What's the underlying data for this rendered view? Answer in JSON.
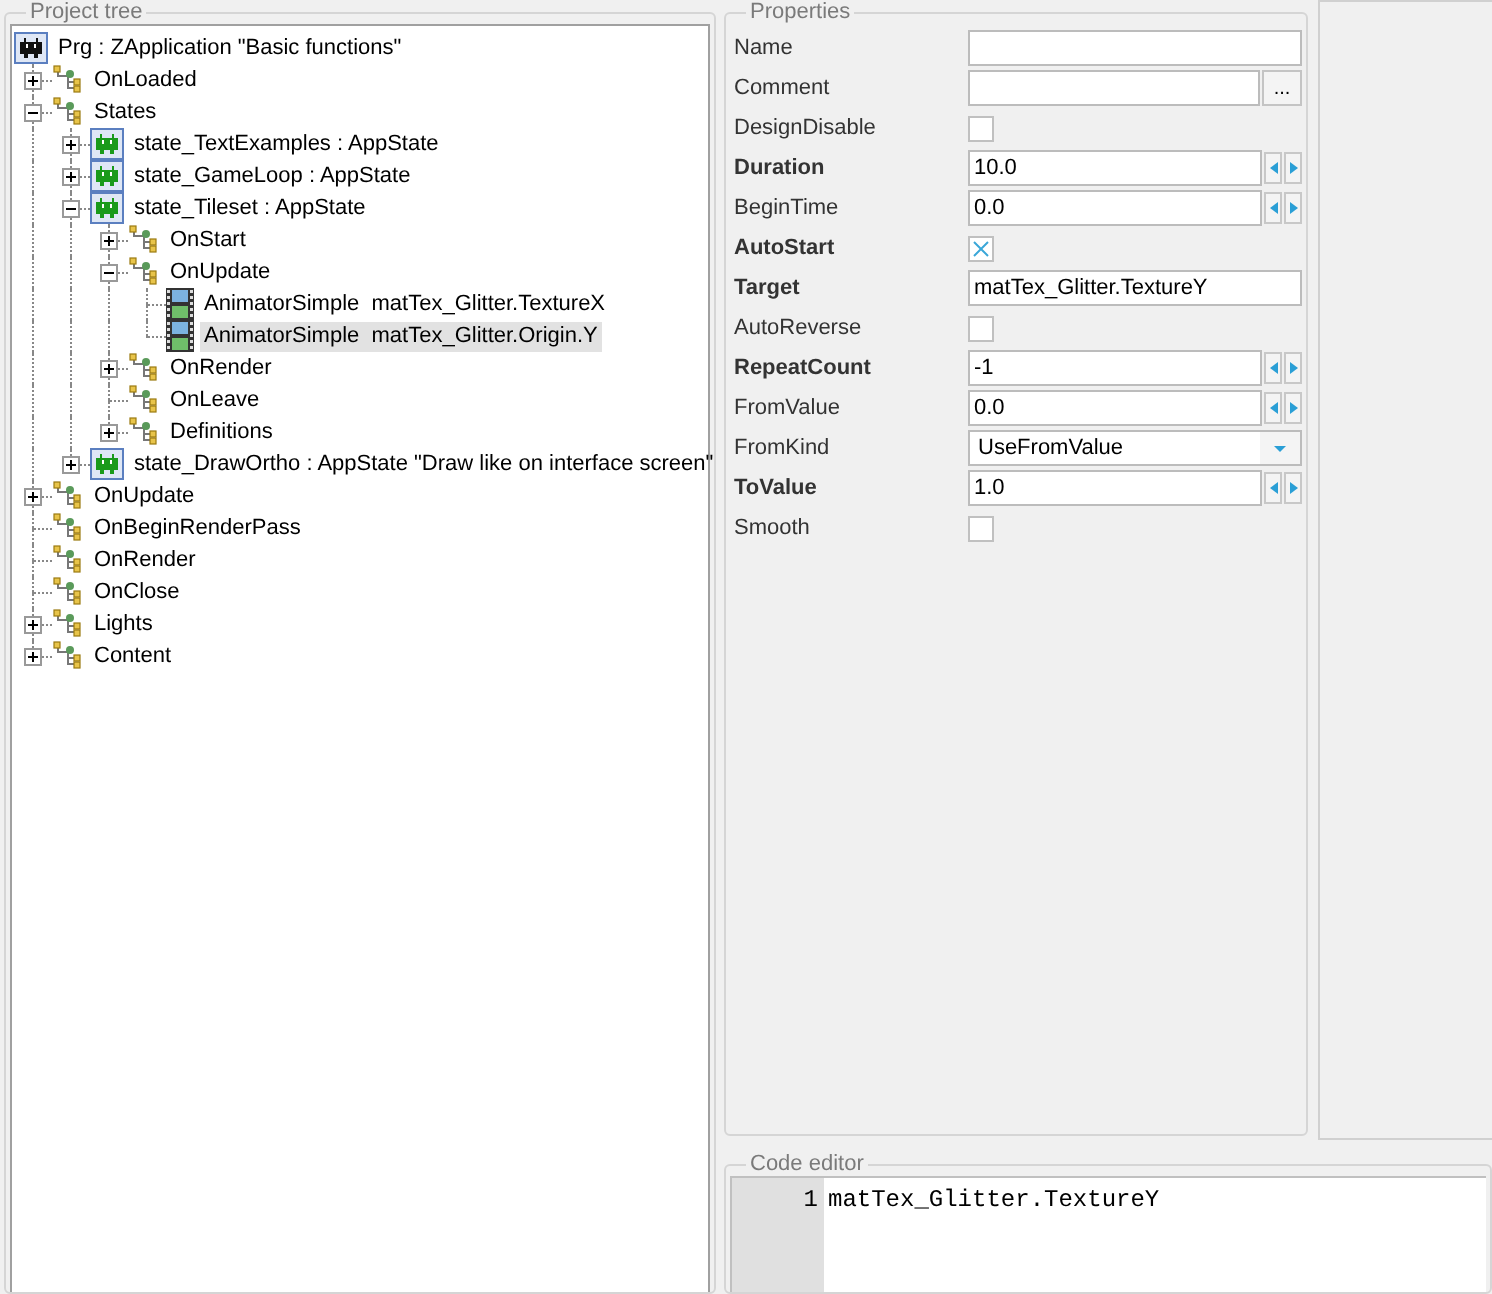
{
  "project_tree": {
    "title": "Project tree",
    "root": {
      "label": "Prg : ZApplication \"Basic functions\"",
      "kind": "app",
      "selected": false,
      "children": [
        {
          "label": "OnLoaded",
          "kind": "component",
          "expanded": false,
          "selected": false
        },
        {
          "label": "States",
          "kind": "component",
          "expanded": true,
          "selected": false,
          "children": [
            {
              "label": "state_TextExamples : AppState",
              "kind": "state",
              "expanded": false,
              "selected": false
            },
            {
              "label": "state_GameLoop : AppState",
              "kind": "state",
              "expanded": false,
              "selected": false
            },
            {
              "label": "state_Tileset : AppState",
              "kind": "state",
              "expanded": true,
              "selected": false,
              "children": [
                {
                  "label": "OnStart",
                  "kind": "component",
                  "expanded": false,
                  "selected": false
                },
                {
                  "label": "OnUpdate",
                  "kind": "component",
                  "expanded": true,
                  "selected": false,
                  "children": [
                    {
                      "label": "AnimatorSimple  matTex_Glitter.TextureX",
                      "kind": "animator",
                      "selected": false
                    },
                    {
                      "label": "AnimatorSimple  matTex_Glitter.Origin.Y",
                      "kind": "animator",
                      "selected": true
                    }
                  ]
                },
                {
                  "label": "OnRender",
                  "kind": "component",
                  "expanded": false,
                  "selected": false
                },
                {
                  "label": "OnLeave",
                  "kind": "component",
                  "selected": false
                },
                {
                  "label": "Definitions",
                  "kind": "component",
                  "expanded": false,
                  "selected": false
                }
              ]
            },
            {
              "label": "state_DrawOrtho : AppState \"Draw like on interface screen\"",
              "kind": "state",
              "expanded": false,
              "selected": false
            }
          ]
        },
        {
          "label": "OnUpdate",
          "kind": "component",
          "expanded": false,
          "selected": false
        },
        {
          "label": "OnBeginRenderPass",
          "kind": "component",
          "selected": false
        },
        {
          "label": "OnRender",
          "kind": "component",
          "selected": false
        },
        {
          "label": "OnClose",
          "kind": "component",
          "selected": false
        },
        {
          "label": "Lights",
          "kind": "component",
          "expanded": false,
          "selected": false
        },
        {
          "label": "Content",
          "kind": "component",
          "expanded": false,
          "selected": false
        }
      ]
    }
  },
  "properties": {
    "title": "Properties",
    "rows": [
      {
        "label": "Name",
        "bold": false,
        "kind": "text",
        "value": ""
      },
      {
        "label": "Comment",
        "bold": false,
        "kind": "text_button",
        "value": "",
        "button": "..."
      },
      {
        "label": "DesignDisable",
        "bold": false,
        "kind": "checkbox",
        "checked": false
      },
      {
        "label": "Duration",
        "bold": true,
        "kind": "spin",
        "value": "10.0"
      },
      {
        "label": "BeginTime",
        "bold": false,
        "kind": "spin",
        "value": "0.0"
      },
      {
        "label": "AutoStart",
        "bold": true,
        "kind": "checkbox",
        "checked": true
      },
      {
        "label": "Target",
        "bold": true,
        "kind": "text",
        "value": "matTex_Glitter.TextureY"
      },
      {
        "label": "AutoReverse",
        "bold": false,
        "kind": "checkbox",
        "checked": false
      },
      {
        "label": "RepeatCount",
        "bold": true,
        "kind": "spin",
        "value": "-1"
      },
      {
        "label": "FromValue",
        "bold": false,
        "kind": "spin",
        "value": "0.0"
      },
      {
        "label": "FromKind",
        "bold": false,
        "kind": "dropdown",
        "value": "UseFromValue"
      },
      {
        "label": "ToValue",
        "bold": true,
        "kind": "spin",
        "value": "1.0"
      },
      {
        "label": "Smooth",
        "bold": false,
        "kind": "checkbox",
        "checked": false
      }
    ]
  },
  "code_editor": {
    "title": "Code editor",
    "lines": [
      {
        "number": "1",
        "text": "matTex_Glitter.TextureY"
      }
    ]
  }
}
